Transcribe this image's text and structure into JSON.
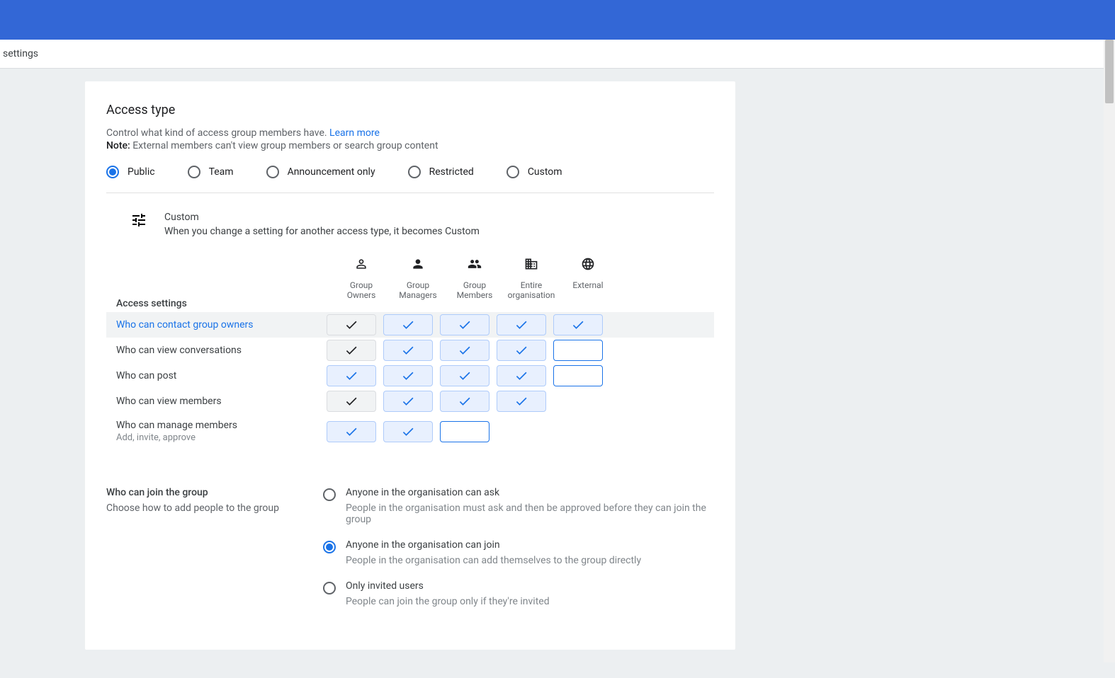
{
  "subbar": {
    "breadcrumb": "settings"
  },
  "section": {
    "title": "Access type",
    "description": "Control what kind of access group members have.",
    "learn_more": "Learn more",
    "note_prefix": "Note:",
    "note_text": " External members can't view group members or search group content"
  },
  "access_types": [
    {
      "id": "public",
      "label": "Public",
      "selected": true
    },
    {
      "id": "team",
      "label": "Team",
      "selected": false
    },
    {
      "id": "announcement",
      "label": "Announcement only",
      "selected": false
    },
    {
      "id": "restricted",
      "label": "Restricted",
      "selected": false
    },
    {
      "id": "custom",
      "label": "Custom",
      "selected": false
    }
  ],
  "custom_info": {
    "title": "Custom",
    "sub": "When you change a setting for another access type, it becomes Custom"
  },
  "matrix": {
    "settings_label": "Access settings",
    "columns": [
      {
        "id": "owners",
        "label": "Group Owners",
        "icon": "person-outline"
      },
      {
        "id": "managers",
        "label": "Group Managers",
        "icon": "person"
      },
      {
        "id": "members",
        "label": "Group Members",
        "icon": "people"
      },
      {
        "id": "org",
        "label": "Entire organisation",
        "icon": "org"
      },
      {
        "id": "external",
        "label": "External",
        "icon": "globe"
      }
    ],
    "rows": [
      {
        "label": "Who can contact group owners",
        "active": true,
        "cells": [
          "grey",
          "blue",
          "blue",
          "blue",
          "blue"
        ]
      },
      {
        "label": "Who can view conversations",
        "active": false,
        "cells": [
          "grey",
          "blue",
          "blue",
          "blue",
          "empty"
        ]
      },
      {
        "label": "Who can post",
        "active": false,
        "cells": [
          "blue",
          "blue",
          "blue",
          "blue",
          "empty"
        ]
      },
      {
        "label": "Who can view members",
        "active": false,
        "cells": [
          "grey",
          "blue",
          "blue",
          "blue",
          "none"
        ]
      },
      {
        "label": "Who can manage members",
        "sublabel": "Add, invite, approve",
        "active": false,
        "cells": [
          "blue",
          "blue",
          "empty",
          "none",
          "none"
        ]
      }
    ]
  },
  "join": {
    "title": "Who can join the group",
    "sub": "Choose how to add people to the group",
    "options": [
      {
        "label": "Anyone in the organisation can ask",
        "sub": "People in the organisation must ask and then be approved before they can join the group",
        "selected": false
      },
      {
        "label": "Anyone in the organisation can join",
        "sub": "People in the organisation can add themselves to the group directly",
        "selected": true
      },
      {
        "label": "Only invited users",
        "sub": "People can join the group only if they're invited",
        "selected": false
      }
    ]
  }
}
